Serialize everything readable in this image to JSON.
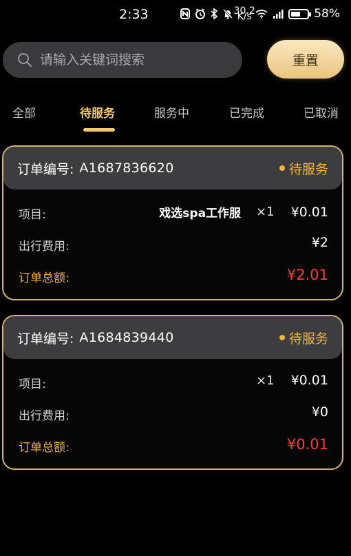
{
  "status_bar": {
    "time": "2:33",
    "icons": [
      "nfc-icon",
      "alarm-icon",
      "bluetooth-icon",
      "mute-icon",
      "net-speed-icon",
      "wifi-icon",
      "signal-icon",
      "battery-icon"
    ],
    "net_speed_value": "30.2",
    "net_speed_unit": "K/s",
    "battery_percent": "58%",
    "battery_level": 0.58
  },
  "search": {
    "placeholder": "请输入关键词搜索",
    "value": ""
  },
  "reset_button": {
    "label": "重置"
  },
  "tabs": [
    {
      "label": "全部",
      "active": false
    },
    {
      "label": "待服务",
      "active": true
    },
    {
      "label": "服务中",
      "active": false
    },
    {
      "label": "已完成",
      "active": false
    },
    {
      "label": "已取消",
      "active": false
    }
  ],
  "orders": [
    {
      "order_no_label": "订单编号:",
      "order_no": "A1687836620",
      "status": "待服务",
      "item_label": "项目:",
      "item_name": "戏选spa工作服",
      "item_qty": "×1",
      "item_price": "¥0.01",
      "travel_label": "出行费用:",
      "travel_fee": "¥2",
      "total_label": "订单总额:",
      "total": "¥2.01"
    },
    {
      "order_no_label": "订单编号:",
      "order_no": "A1684839440",
      "status": "待服务",
      "item_label": "项目:",
      "item_name": "",
      "item_qty": "×1",
      "item_price": "¥0.01",
      "travel_label": "出行费用:",
      "travel_fee": "¥0",
      "total_label": "订单总额:",
      "total": "¥0.01"
    }
  ],
  "colors": {
    "accent_gold": "#f2c868",
    "status_orange": "#f2b43a",
    "total_red": "#ff3a3a",
    "card_border": "#d9b46a",
    "card_header": "#3d3d3f"
  }
}
